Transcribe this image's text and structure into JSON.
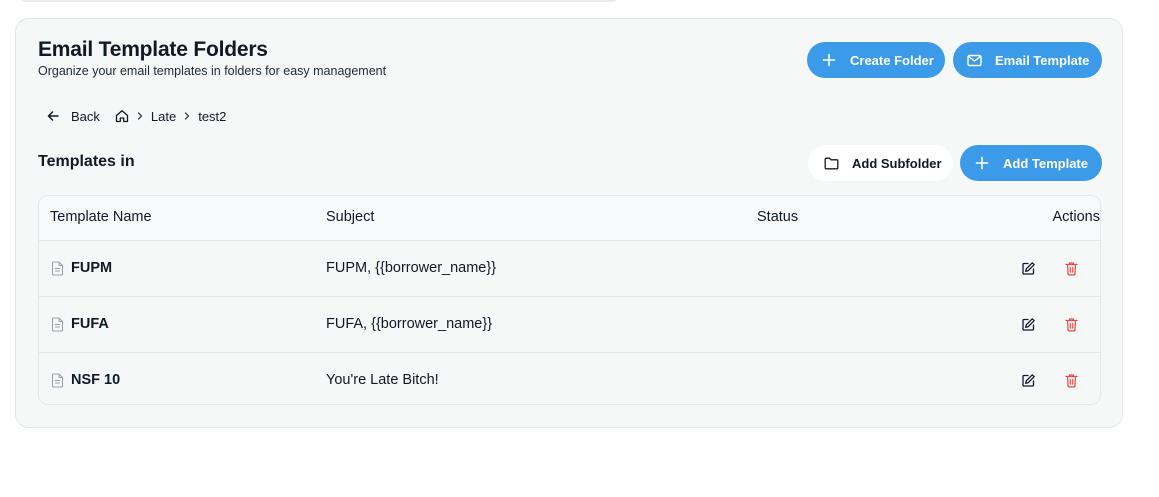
{
  "header": {
    "title": "Email Template Folders",
    "subtitle": "Organize your email templates in folders for easy management",
    "create_folder_label": "Create Folder",
    "email_template_label": "Email Template"
  },
  "breadcrumb": {
    "back_label": "Back",
    "items": [
      "Late",
      "test2"
    ]
  },
  "section": {
    "title": "Templates in",
    "add_subfolder_label": "Add Subfolder",
    "add_template_label": "Add Template"
  },
  "table": {
    "columns": [
      "Template Name",
      "Subject",
      "Status",
      "Actions"
    ],
    "rows": [
      {
        "name": "FUPM",
        "subject": "FUPM, {{borrower_name}}",
        "status": ""
      },
      {
        "name": "FUFA",
        "subject": "FUFA, {{borrower_name}}",
        "status": ""
      },
      {
        "name": "NSF 10",
        "subject": "You're Late Bitch!",
        "status": ""
      }
    ]
  },
  "icons": {
    "create_folder": "plus-icon",
    "email_template": "mail-icon",
    "back": "arrow-left-icon",
    "home": "home-icon",
    "separator": "chevron-right-icon",
    "add_subfolder": "folder-icon",
    "add_template": "plus-icon",
    "row_file": "file-text-icon",
    "row_edit": "edit-icon",
    "row_delete": "trash-icon"
  },
  "colors": {
    "primary": "#3b9be8",
    "delete": "#ef4444",
    "card_bg": "#f6f7f7"
  }
}
